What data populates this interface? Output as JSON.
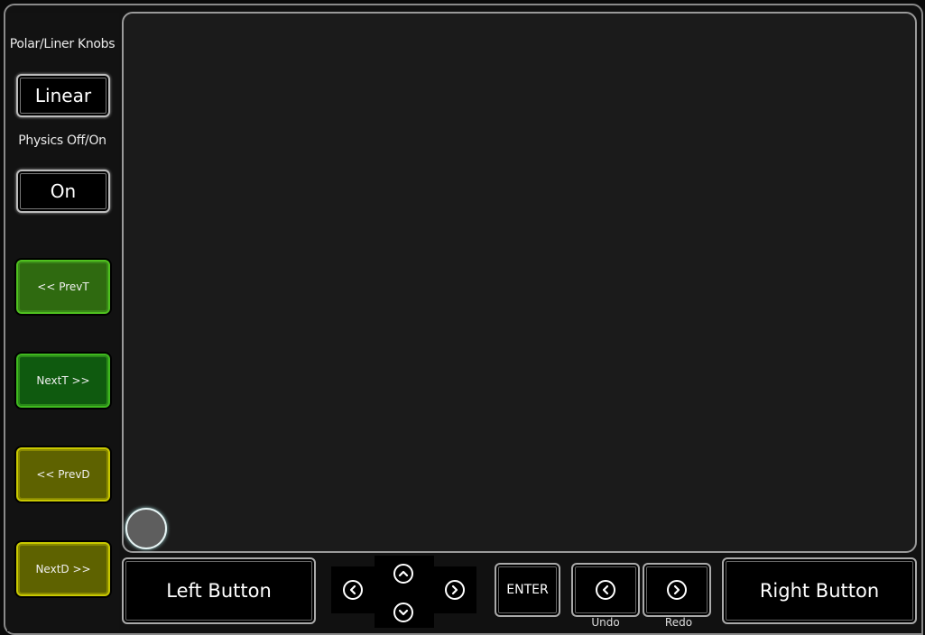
{
  "sidebar": {
    "knob_mode_label": "Polar/Liner Knobs",
    "knob_mode_value": "Linear",
    "physics_label": "Physics Off/On",
    "physics_value": "On",
    "buttons": [
      {
        "label": "<< PrevT",
        "color": "#2f6a10"
      },
      {
        "label": "NextT >>",
        "color": "#0f5a0f"
      },
      {
        "label": "<< PrevD",
        "color": "#5e6200"
      },
      {
        "label": "NextD >>",
        "color": "#5e6200"
      }
    ]
  },
  "bottom": {
    "left_button": "Left Button",
    "right_button": "Right Button",
    "enter_button": "ENTER",
    "undo_label": "Undo",
    "redo_label": "Redo",
    "dpad": [
      "left-arrow",
      "up-arrow",
      "down-arrow",
      "right-arrow"
    ]
  },
  "colors": {
    "background": "#111111",
    "canvas": "#1b1b1b",
    "green_accent": "#4fbf1f",
    "yellow_accent": "#c8c800"
  }
}
